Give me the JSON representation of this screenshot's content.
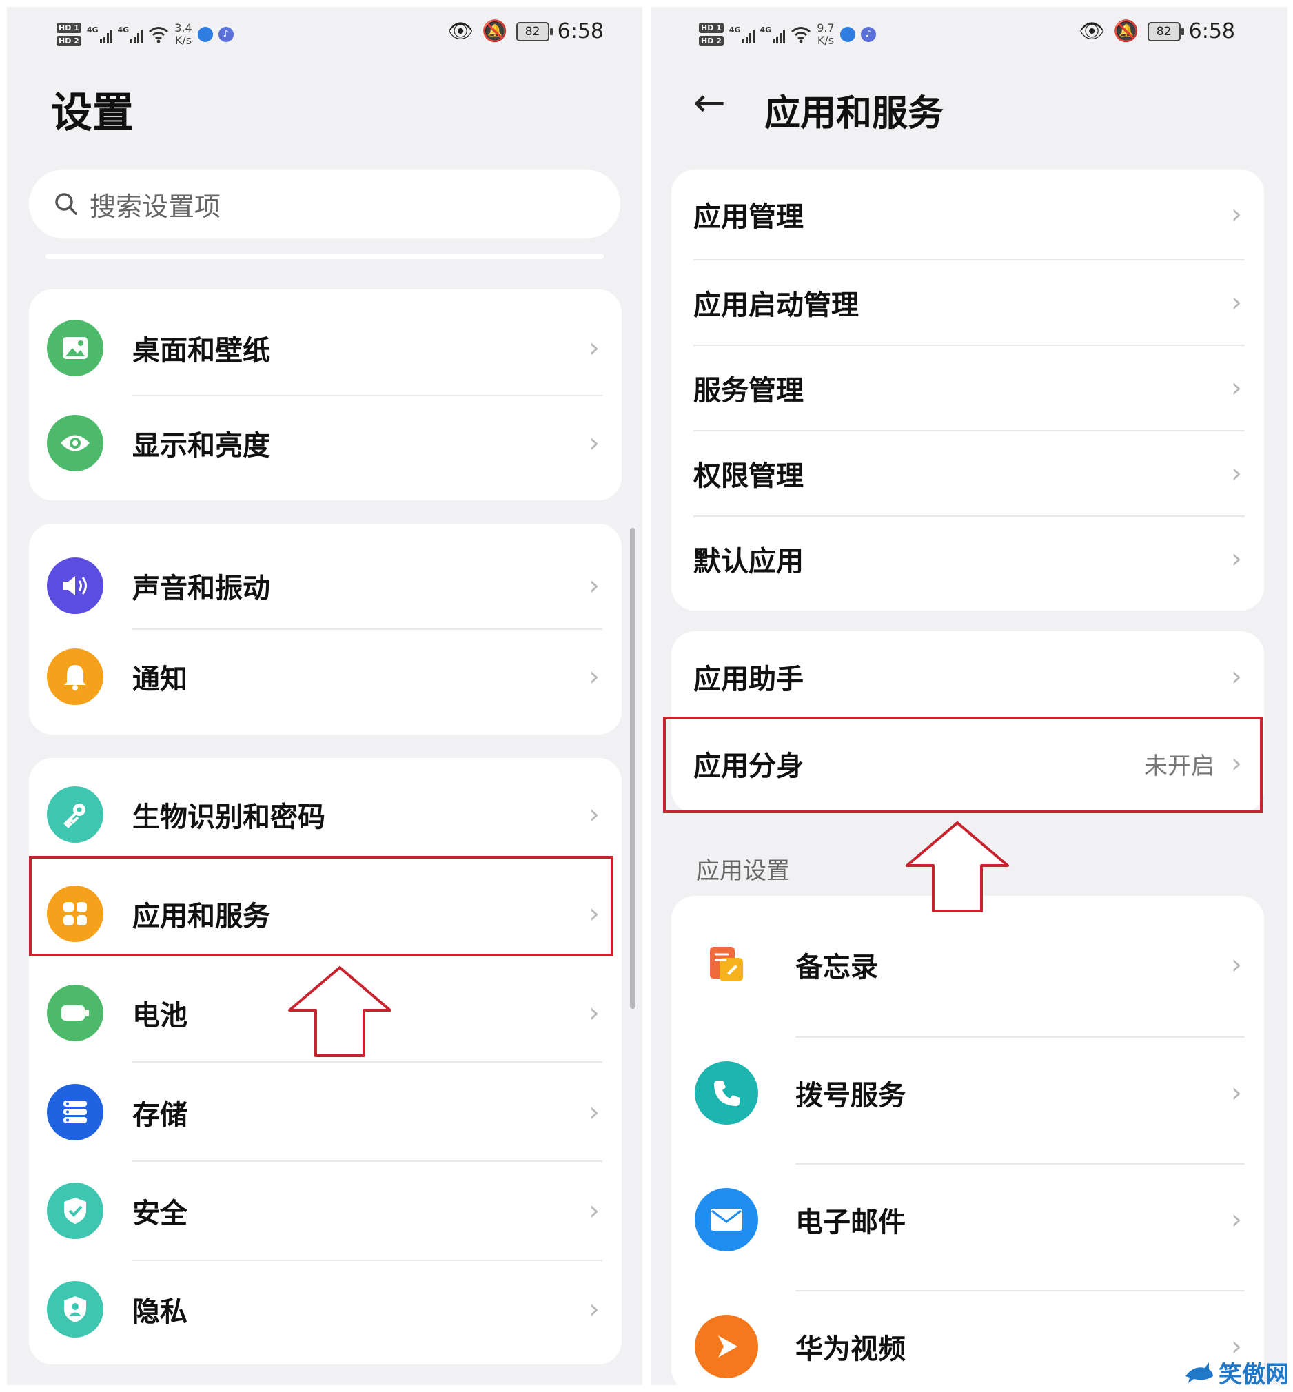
{
  "left": {
    "status": {
      "hd1": "HD 1",
      "hd2": "HD 2",
      "net1": "4G",
      "net2": "4G",
      "speed_value": "3.4",
      "speed_unit": "K/s",
      "battery": "82",
      "time": "6:58"
    },
    "title": "设置",
    "search_placeholder": "搜索设置项",
    "groups": [
      {
        "items": [
          {
            "label": "桌面和壁纸",
            "icon": "wallpaper-icon",
            "color": "#4cba6a"
          },
          {
            "label": "显示和亮度",
            "icon": "eye-icon",
            "color": "#4cba6a"
          }
        ]
      },
      {
        "items": [
          {
            "label": "声音和振动",
            "icon": "speaker-icon",
            "color": "#5b4de0"
          },
          {
            "label": "通知",
            "icon": "bell-icon",
            "color": "#f5a11c"
          }
        ]
      },
      {
        "items": [
          {
            "label": "生物识别和密码",
            "icon": "key-icon",
            "color": "#3ec6b0"
          },
          {
            "label": "应用和服务",
            "icon": "apps-grid-icon",
            "color": "#f5a11c"
          },
          {
            "label": "电池",
            "icon": "battery-icon",
            "color": "#4cba6a"
          },
          {
            "label": "存储",
            "icon": "storage-icon",
            "color": "#1f63e0"
          },
          {
            "label": "安全",
            "icon": "shield-icon",
            "color": "#3ec6b0"
          },
          {
            "label": "隐私",
            "icon": "privacy-icon",
            "color": "#3ec6b0"
          }
        ]
      }
    ],
    "chevron": "›"
  },
  "right": {
    "status": {
      "hd1": "HD 1",
      "hd2": "HD 2",
      "net1": "4G",
      "net2": "4G",
      "speed_value": "9.7",
      "speed_unit": "K/s",
      "battery": "82",
      "time": "6:58"
    },
    "back": "←",
    "title": "应用和服务",
    "group1": [
      "应用管理",
      "应用启动管理",
      "服务管理",
      "权限管理",
      "默认应用"
    ],
    "group2": [
      {
        "label": "应用助手",
        "value": ""
      },
      {
        "label": "应用分身",
        "value": "未开启"
      }
    ],
    "section": "应用设置",
    "apps": [
      {
        "label": "备忘录",
        "icon": "memo-icon"
      },
      {
        "label": "拨号服务",
        "icon": "phone-icon",
        "color": "#1db5b0"
      },
      {
        "label": "电子邮件",
        "icon": "mail-icon",
        "color": "#1f8ef0"
      },
      {
        "label": "华为视频",
        "icon": "video-play-icon",
        "color": "#f5781c"
      }
    ],
    "chevron": "›"
  },
  "annotations": {
    "highlight_color": "#c8242f"
  },
  "watermark": {
    "text": "笑傲网",
    "url": "xajjn.com"
  }
}
